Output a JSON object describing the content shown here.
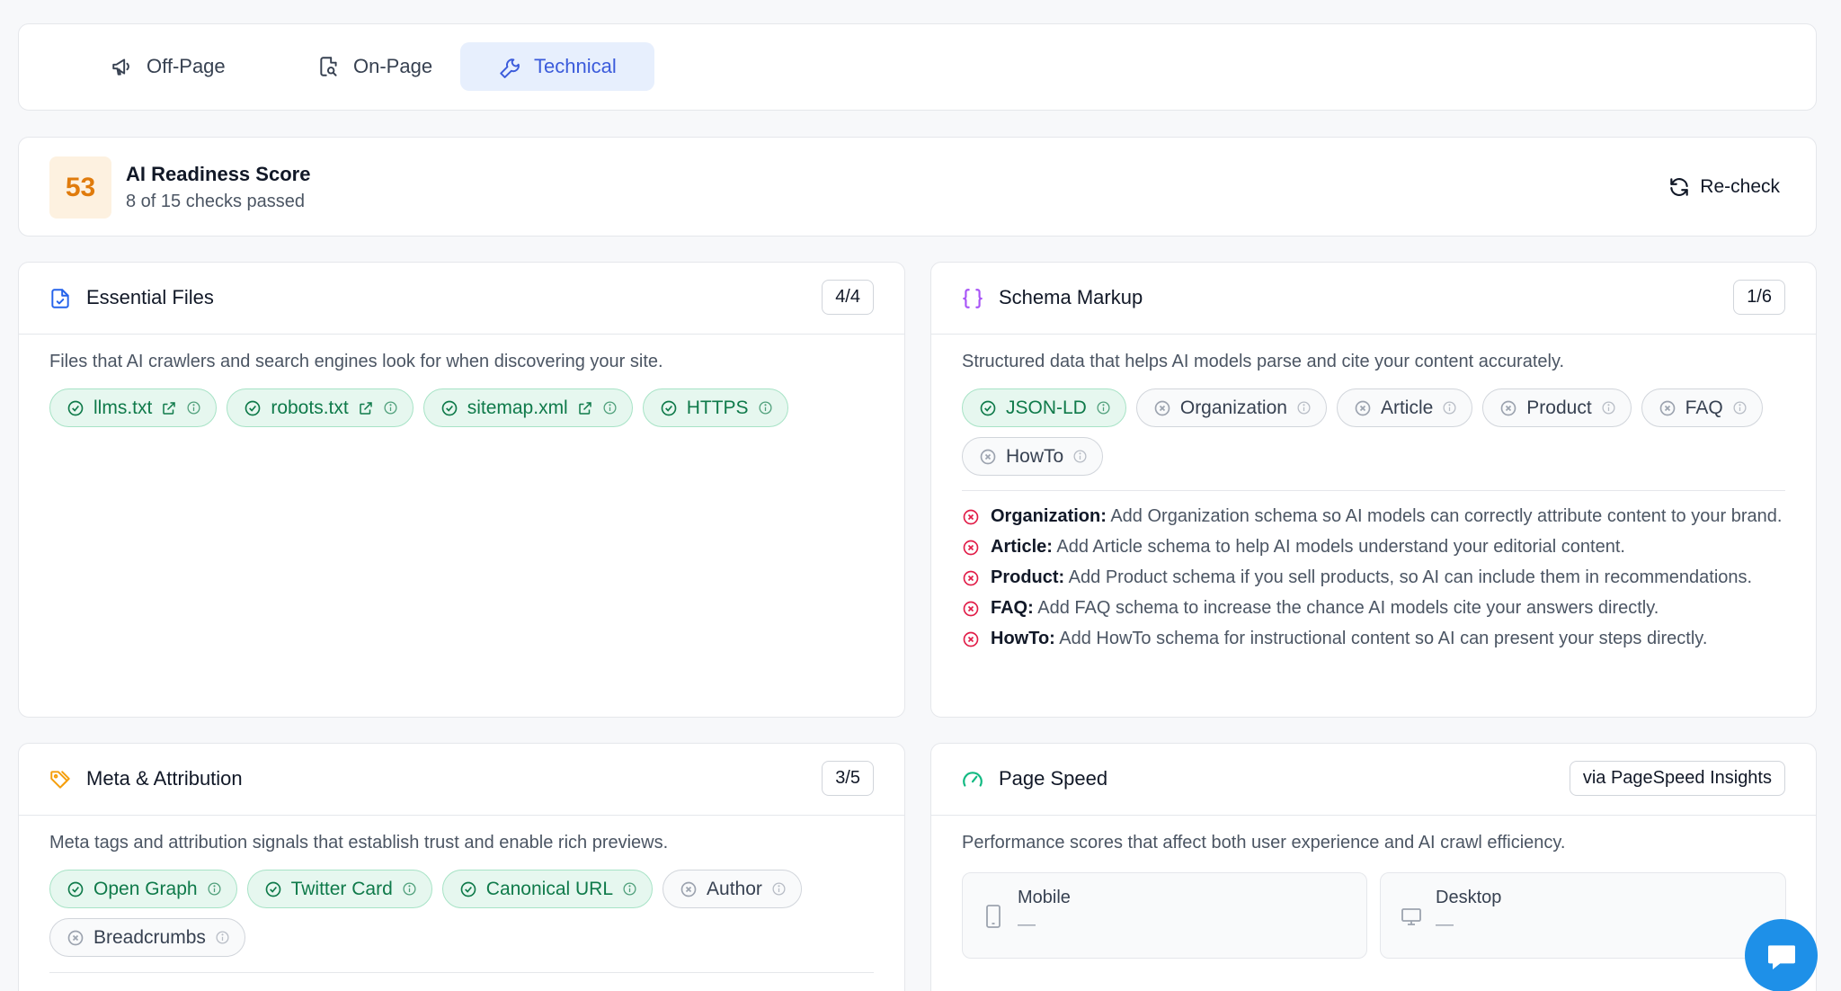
{
  "tabs": [
    {
      "label": "Off-Page",
      "icon": "megaphone-icon"
    },
    {
      "label": "On-Page",
      "icon": "file-search-icon"
    },
    {
      "label": "Technical",
      "icon": "wrench-icon",
      "active": true
    }
  ],
  "score": {
    "value": "53",
    "title": "AI Readiness Score",
    "subtitle": "8 of 15 checks passed",
    "recheck_label": "Re-check"
  },
  "essential": {
    "title": "Essential Files",
    "badge": "4/4",
    "description": "Files that AI crawlers and search engines look for when discovering your site.",
    "chips": [
      {
        "label": "llms.txt",
        "status": "pass"
      },
      {
        "label": "robots.txt",
        "status": "pass"
      },
      {
        "label": "sitemap.xml",
        "status": "pass"
      },
      {
        "label": "HTTPS",
        "status": "pass"
      }
    ]
  },
  "schema": {
    "title": "Schema Markup",
    "badge": "1/6",
    "description": "Structured data that helps AI models parse and cite your content accurately.",
    "chips": [
      {
        "label": "JSON-LD",
        "status": "pass"
      },
      {
        "label": "Organization",
        "status": "fail"
      },
      {
        "label": "Article",
        "status": "fail"
      },
      {
        "label": "Product",
        "status": "fail"
      },
      {
        "label": "FAQ",
        "status": "fail"
      },
      {
        "label": "HowTo",
        "status": "fail"
      }
    ],
    "issues": [
      {
        "name": "Organization:",
        "text": "Add Organization schema so AI models can correctly attribute content to your brand."
      },
      {
        "name": "Article:",
        "text": "Add Article schema to help AI models understand your editorial content."
      },
      {
        "name": "Product:",
        "text": "Add Product schema if you sell products, so AI can include them in recommendations."
      },
      {
        "name": "FAQ:",
        "text": "Add FAQ schema to increase the chance AI models cite your answers directly."
      },
      {
        "name": "HowTo:",
        "text": "Add HowTo schema for instructional content so AI can present your steps directly."
      }
    ]
  },
  "meta": {
    "title": "Meta & Attribution",
    "badge": "3/5",
    "description": "Meta tags and attribution signals that establish trust and enable rich previews.",
    "chips": [
      {
        "label": "Open Graph",
        "status": "pass"
      },
      {
        "label": "Twitter Card",
        "status": "pass"
      },
      {
        "label": "Canonical URL",
        "status": "pass"
      },
      {
        "label": "Author",
        "status": "fail"
      },
      {
        "label": "Breadcrumbs",
        "status": "fail"
      }
    ]
  },
  "speed": {
    "title": "Page Speed",
    "badge": "via PageSpeed Insights",
    "description": "Performance scores that affect both user experience and AI crawl efficiency.",
    "mobile_label": "Mobile",
    "mobile_value": "—",
    "desktop_label": "Desktop",
    "desktop_value": "—"
  },
  "colors": {
    "accent": "#3b5bdb",
    "pass": "#0f7a4a",
    "fail": "#e11d48",
    "score": "#e07b0c",
    "chat": "#1e90e8"
  }
}
